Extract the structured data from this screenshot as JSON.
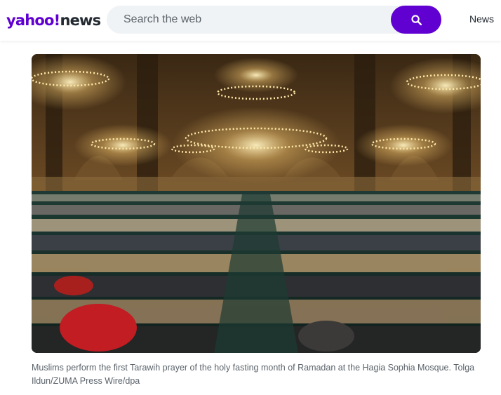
{
  "header": {
    "logo_main": "yahoo",
    "logo_bang": "!",
    "logo_section": "news",
    "nav_news_label": "News"
  },
  "search": {
    "placeholder": "Search the web",
    "icon": "search-icon"
  },
  "article": {
    "image_caption": "Muslims perform the first Tarawih prayer of the holy fasting month of Ramadan at the Hagia Sophia Mosque. Tolga Ildun/ZUMA Press Wire/dpa"
  },
  "colors": {
    "brand": "#6001d2",
    "text_primary": "#232a31",
    "text_secondary": "#5b636a",
    "search_bg": "#f0f3f5"
  }
}
